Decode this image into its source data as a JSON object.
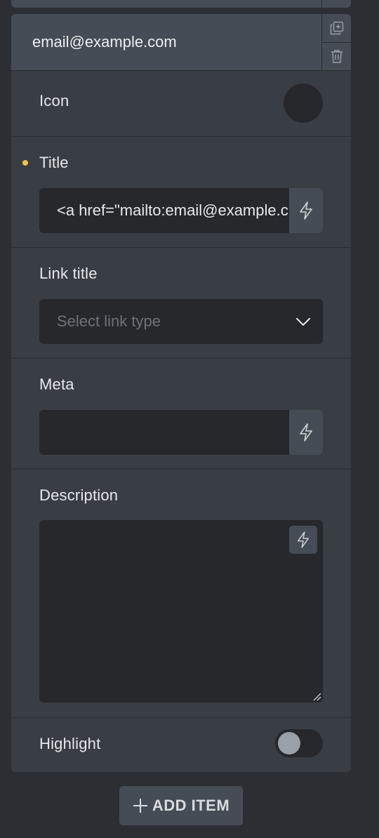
{
  "item": {
    "title": "email@example.com"
  },
  "fields": {
    "icon_label": "Icon",
    "title_label": "Title",
    "title_value": "<a href=\"mailto:email@example.com\">email@example.com</a>",
    "link_title_label": "Link title",
    "link_placeholder": "Select link type",
    "meta_label": "Meta",
    "meta_value": "",
    "description_label": "Description",
    "description_value": "",
    "highlight_label": "Highlight",
    "highlight_on": false
  },
  "actions": {
    "add_item_label": "ADD ITEM"
  },
  "icons": {
    "duplicate": "duplicate-icon",
    "delete": "trash-icon",
    "dynamic": "bolt-icon",
    "chevron": "chevron-down-icon",
    "add": "plus-icon"
  },
  "colors": {
    "background": "#2b2e33",
    "panel": "#393d44",
    "header": "#464c55",
    "input": "#26282c",
    "changed_dot": "#f5c542"
  }
}
